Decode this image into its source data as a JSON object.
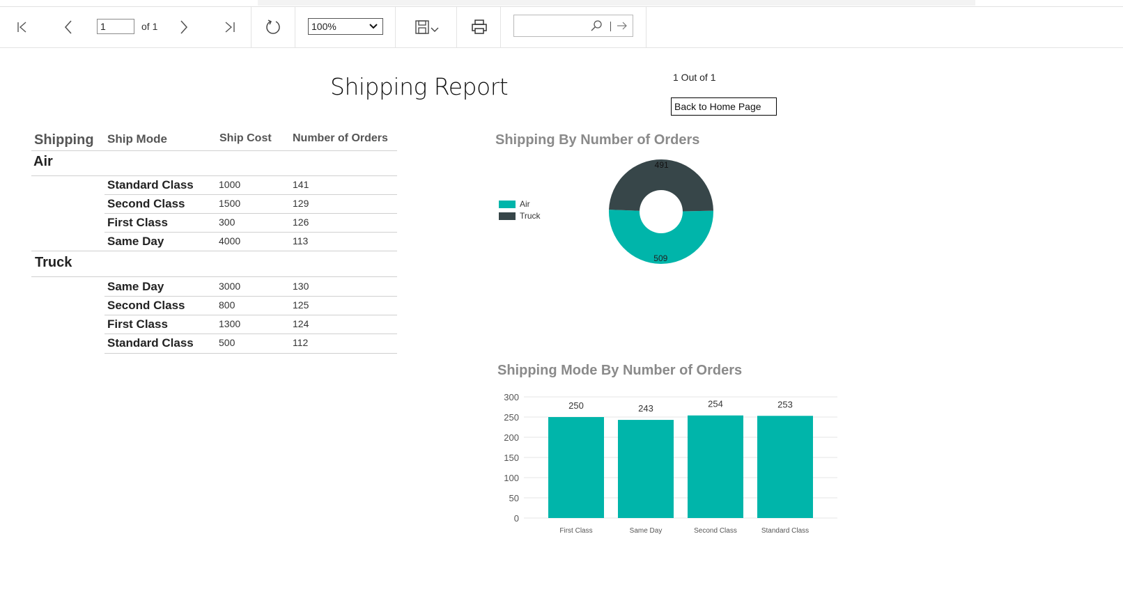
{
  "toolbar": {
    "page_value": "1",
    "of_label": "of 1",
    "zoom_value": "100%",
    "search_value": ""
  },
  "report": {
    "title": "Shipping Report",
    "page_count": "1 Out of 1",
    "home_button": "Back to Home Page"
  },
  "table": {
    "headers": [
      "Shipping",
      "Ship Mode",
      "Ship Cost",
      "Number of Orders"
    ],
    "groups": [
      {
        "name": "Air",
        "rows": [
          {
            "mode": "Standard Class",
            "cost": "1000",
            "orders": "141"
          },
          {
            "mode": "Second Class",
            "cost": "1500",
            "orders": "129"
          },
          {
            "mode": "First Class",
            "cost": "300",
            "orders": "126"
          },
          {
            "mode": "Same Day",
            "cost": "4000",
            "orders": "113"
          }
        ]
      },
      {
        "name": "Truck",
        "rows": [
          {
            "mode": "Same Day",
            "cost": "3000",
            "orders": "130"
          },
          {
            "mode": "Second Class",
            "cost": "800",
            "orders": "125"
          },
          {
            "mode": "First Class",
            "cost": "1300",
            "orders": "124"
          },
          {
            "mode": "Standard Class",
            "cost": "500",
            "orders": "112"
          }
        ]
      }
    ]
  },
  "colors": {
    "teal": "#00b5aa",
    "dark": "#374649",
    "grid": "#e4e4e4",
    "title_gray": "#8a8a8a"
  },
  "chart_data": [
    {
      "type": "pie",
      "variant": "donut",
      "title": "Shipping By Number of Orders",
      "categories": [
        "Air",
        "Truck"
      ],
      "values": [
        509,
        491
      ],
      "colors": [
        "#00b5aa",
        "#374649"
      ],
      "legend": "left"
    },
    {
      "type": "bar",
      "title": "Shipping Mode By Number of Orders",
      "categories": [
        "First Class",
        "Same Day",
        "Second Class",
        "Standard Class"
      ],
      "values": [
        250,
        243,
        254,
        253
      ],
      "ylim": [
        0,
        300
      ],
      "yticks": [
        0,
        50,
        100,
        150,
        200,
        250,
        300
      ],
      "grid": true,
      "color": "#00b5aa"
    }
  ]
}
